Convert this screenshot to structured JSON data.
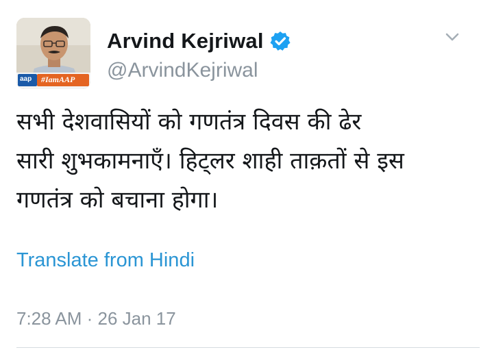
{
  "author": {
    "display_name": "Arvind Kejriwal",
    "handle": "@ArvindKejriwal",
    "verified": true,
    "avatar_badge_left": "aap",
    "avatar_badge_right": "#IamAAP"
  },
  "tweet": {
    "text": "सभी देशवासियों को गणतंत्र दिवस की ढेर\nसारी शुभकामनाएँ। हिट्लर शाही ताक़तों से इस\nगणतंत्र को बचाना होगा।",
    "translate_label": "Translate from Hindi",
    "timestamp": "7:28 AM · 26 Jan 17"
  },
  "icons": {
    "verified": "verified-badge-icon",
    "menu": "chevron-down-icon"
  },
  "colors": {
    "link": "#2a95d4",
    "verified": "#1da1f2",
    "secondary_text": "#8a949d",
    "primary_text": "#14171a"
  }
}
